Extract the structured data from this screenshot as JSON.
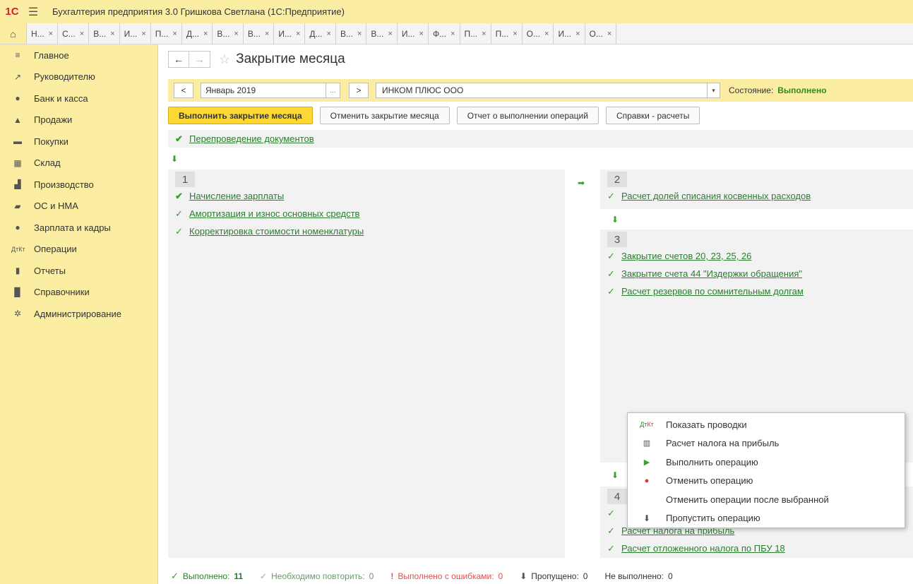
{
  "app": {
    "logo": "1С",
    "title": "Бухгалтерия предприятия 3.0 Гришкова Светлана  (1С:Предприятие)"
  },
  "tabs": [
    {
      "label": "Н..."
    },
    {
      "label": "С..."
    },
    {
      "label": "В..."
    },
    {
      "label": "И..."
    },
    {
      "label": "П..."
    },
    {
      "label": "Д..."
    },
    {
      "label": "В..."
    },
    {
      "label": "В..."
    },
    {
      "label": "И..."
    },
    {
      "label": "Д..."
    },
    {
      "label": "В..."
    },
    {
      "label": "В..."
    },
    {
      "label": "И..."
    },
    {
      "label": "Ф..."
    },
    {
      "label": "П..."
    },
    {
      "label": "П..."
    },
    {
      "label": "О..."
    },
    {
      "label": "И..."
    },
    {
      "label": "О..."
    }
  ],
  "sidebar": {
    "items": [
      {
        "label": "Главное",
        "icon": "menu-icon"
      },
      {
        "label": "Руководителю",
        "icon": "trend-icon"
      },
      {
        "label": "Банк и касса",
        "icon": "ruble-icon"
      },
      {
        "label": "Продажи",
        "icon": "shop-icon"
      },
      {
        "label": "Покупки",
        "icon": "cart-icon"
      },
      {
        "label": "Склад",
        "icon": "warehouse-icon"
      },
      {
        "label": "Производство",
        "icon": "factory-icon"
      },
      {
        "label": "ОС и НМА",
        "icon": "truck-icon"
      },
      {
        "label": "Зарплата и кадры",
        "icon": "person-icon"
      },
      {
        "label": "Операции",
        "icon": "dt-kt-icon"
      },
      {
        "label": "Отчеты",
        "icon": "bar-chart-icon"
      },
      {
        "label": "Справочники",
        "icon": "book-icon"
      },
      {
        "label": "Администрирование",
        "icon": "gear-icon"
      }
    ]
  },
  "page": {
    "title": "Закрытие месяца"
  },
  "filter": {
    "prev": "<",
    "period": "Январь 2019",
    "dots": "...",
    "next": ">",
    "organization": "ИНКОМ ПЛЮС ООО",
    "state_label": "Состояние:",
    "state_value": "Выполнено"
  },
  "actions": {
    "run": "Выполнить закрытие месяца",
    "cancel": "Отменить закрытие месяца",
    "report": "Отчет о выполнении операций",
    "refs": "Справки - расчеты"
  },
  "repost": {
    "label": "Перепроведение документов"
  },
  "stage1": {
    "num": "1",
    "ops": [
      {
        "label": "Начисление зарплаты"
      },
      {
        "label": "Амортизация и износ основных средств"
      },
      {
        "label": "Корректировка стоимости номенклатуры"
      }
    ]
  },
  "stage2": {
    "num": "2",
    "ops": [
      {
        "label": "Расчет долей списания косвенных расходов"
      }
    ]
  },
  "stage3": {
    "num": "3",
    "ops": [
      {
        "label": "Закрытие счетов 20, 23, 25, 26"
      },
      {
        "label": "Закрытие счета 44 \"Издержки обращения\""
      },
      {
        "label": "Расчет резервов по сомнительным долгам"
      }
    ]
  },
  "stage4": {
    "num": "4",
    "ops": [
      {
        "label": "Расчет налога на прибыль"
      },
      {
        "label": "Расчет отложенного налога по ПБУ 18"
      }
    ]
  },
  "context_menu": {
    "items": [
      {
        "label": "Показать проводки",
        "icon": "dt-kt-icon"
      },
      {
        "label": "Расчет налога на прибыль",
        "icon": "report-icon"
      },
      {
        "label": "Выполнить операцию",
        "icon": "execute-icon"
      },
      {
        "label": "Отменить операцию",
        "icon": "cancel-op-icon"
      },
      {
        "label": "Отменить операции после выбранной",
        "icon": ""
      },
      {
        "label": "Пропустить операцию",
        "icon": "skip-arrow-icon"
      }
    ]
  },
  "status": {
    "done_label": "Выполнено:",
    "done_count": "11",
    "repeat_label": "Необходимо повторить:",
    "repeat_count": "0",
    "errors_label": "Выполнено с ошибками:",
    "errors_count": "0",
    "skipped_label": "Пропущено:",
    "skipped_count": "0",
    "notdone_label": "Не выполнено:",
    "notdone_count": "0"
  },
  "colors": {
    "panel_yellow": "#fbeda2",
    "accent_button": "#fdd835",
    "link_green": "#2a7e2e",
    "error_red": "#e05050"
  }
}
